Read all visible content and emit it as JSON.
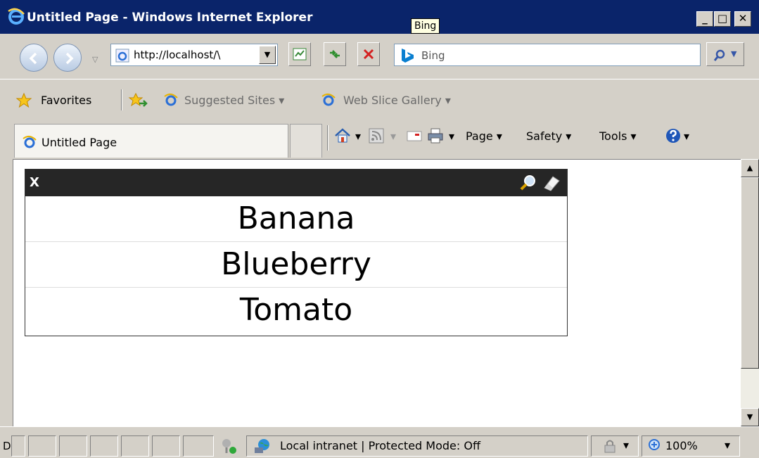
{
  "window": {
    "title": "Untitled Page - Windows Internet Explorer",
    "tooltip": "Bing",
    "min_label": "_",
    "max_label": "□",
    "close_label": "✕"
  },
  "address": {
    "url": "http://localhost/\\",
    "search_placeholder": "Bing"
  },
  "favorites": {
    "label": "Favorites",
    "links": [
      "Suggested Sites ▾",
      "Web Slice Gallery ▾"
    ]
  },
  "tab": {
    "label": "Untitled Page"
  },
  "commands": {
    "page": "Page ▾",
    "safety": "Safety ▾",
    "tools": "Tools ▾"
  },
  "panel": {
    "close_label": "X",
    "items": [
      "Banana",
      "Blueberry",
      "Tomato"
    ]
  },
  "status": {
    "left": "D",
    "zone": "Local intranet | Protected Mode: Off",
    "zoom": "100%"
  },
  "colors": {
    "titlebar": "#0a246a",
    "chrome": "#d4d0c8",
    "panel_header": "#262626"
  }
}
